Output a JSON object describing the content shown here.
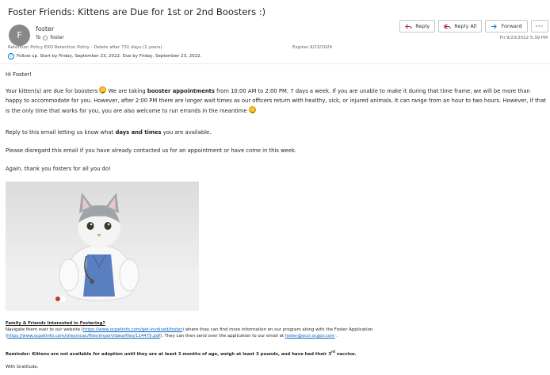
{
  "email": {
    "subject": "Foster Friends: Kittens are Due for 1st or 2nd Boosters :)",
    "sender_initial": "F",
    "sender_name": "foster",
    "to_label": "To",
    "to_name": "foster",
    "retention_policy": "Retention Policy   EXO Retention Policy - Delete after 731 days (2 years)",
    "expires": "Expires   9/23/2024",
    "followup": "Follow up.  Start by Friday, September 23, 2022.  Due by Friday, September 23, 2022.",
    "sent_date": "Fri 9/23/2022 5:39 PM"
  },
  "actions": {
    "reply": "Reply",
    "reply_all": "Reply All",
    "forward": "Forward",
    "more": "···"
  },
  "body": {
    "greeting": "Hi Foster!",
    "p1_a": "Your kitten(s) are due for boosters ",
    "p1_b": " We are taking ",
    "p1_bold": "booster appointments",
    "p1_c": " from 10:00 AM to 2:00 PM, 7 days a week. If you are unable to make it during that time frame, we will be more than happy to accommodate for you. However, after 2:00 PM there are longer wait times as our officers return with healthy, sick, or injured animals. It can range from an hour to two hours. However, if that is the only time that works for you, you are also welcome to run errands in the meantime ",
    "p2_a": "Reply to this email letting us know what ",
    "p2_bold": "days and times",
    "p2_b": " you are available.",
    "p3": "Please disregard this email if you have already contacted us for an appointment or have come in this week.",
    "p4": "Again, thank you fosters for all you do!",
    "ff_heading": "Family & Friends Interested in Fostering?",
    "ff_a": "Navigate them over to our website (",
    "ff_link1": "https://www.ocpetinfo.com/get-involved/foster",
    "ff_b": ") where they can find more information on our program along with the Foster Application",
    "ff_c": "(",
    "ff_link2": "https://www.ocpetinfo.com/sites/ocac/files/import/data/files/114475.pdf",
    "ff_d": "). They can then send over the application to our email at ",
    "ff_email": "foster@occr.ocgov.com",
    "ff_e": " .",
    "reminder_label": "Reminder:",
    "reminder_text": " Kittens are not available for adoption until they are at least 3 months of age, weigh at least 3 pounds, and have had their 3",
    "reminder_sup": "rd",
    "reminder_end": " vaccine.",
    "closing": "With Gratitude,"
  },
  "colors": {
    "link": "#0563c1",
    "accent": "#0078d4",
    "avatar_bg": "#8a8886",
    "emoji": "#f7c62f"
  },
  "icons": [
    "reply-icon",
    "reply-all-icon",
    "forward-icon",
    "more-icon",
    "info-icon",
    "smile-emoji-icon"
  ]
}
